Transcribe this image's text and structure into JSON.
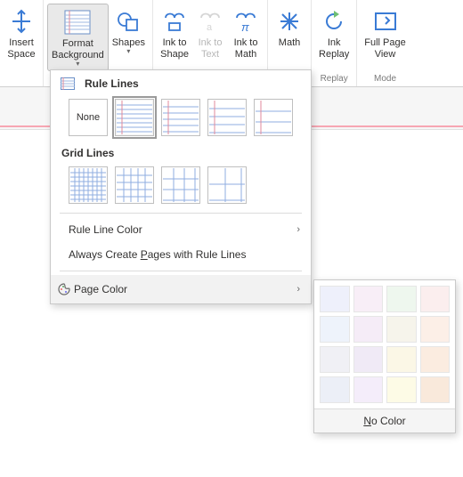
{
  "ribbon": {
    "insert_space": "Insert\nSpace",
    "format_background": "Format\nBackground",
    "shapes": "Shapes",
    "ink_to_shape": "Ink to\nShape",
    "ink_to_text": "Ink to\nText",
    "ink_to_math": "Ink to\nMath",
    "math": "Math",
    "ink_replay": "Ink\nReplay",
    "full_page_view": "Full Page\nView",
    "group_replay": "Replay",
    "group_mode": "Mode"
  },
  "dropdown": {
    "rule_lines": "Rule Lines",
    "none": "None",
    "grid_lines": "Grid Lines",
    "rule_line_color": "Rule Line Color",
    "always_create": "Always Create Pages with Rule Lines",
    "page_color": "Page Color"
  },
  "flyout": {
    "no_color": "No Color",
    "colors": [
      "#eef0fb",
      "#f8eef7",
      "#eef7ee",
      "#fbeeee",
      "#eef3fb",
      "#f5ecf7",
      "#f6f4eb",
      "#fcefe7",
      "#f0f0f5",
      "#f0eaf6",
      "#fbf7e6",
      "#fbece0",
      "#eceff7",
      "#f4edfa",
      "#fdfbe6",
      "#f9e9db"
    ]
  }
}
